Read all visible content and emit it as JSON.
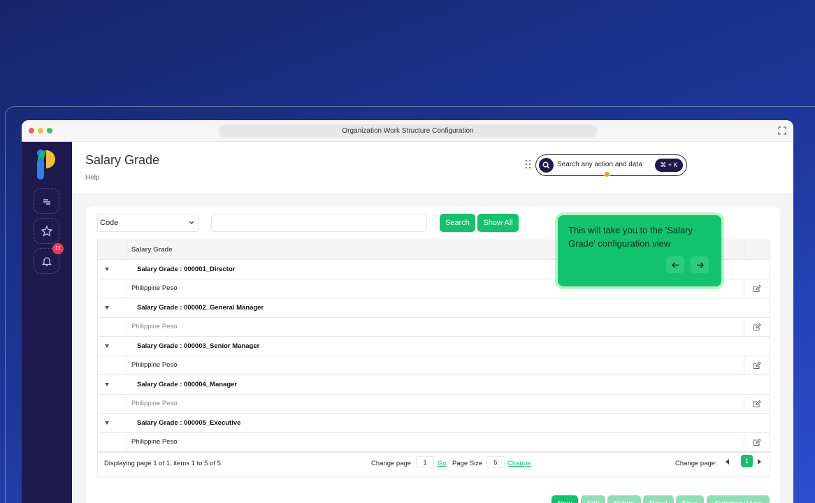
{
  "window": {
    "url_title": "Organization Work Structure Configuration"
  },
  "sidebar": {
    "notification_count": "11"
  },
  "header": {
    "title": "Salary Grade",
    "help": "Help",
    "search_placeholder": "Search any action and data",
    "shortcut": "⌘ + K"
  },
  "filters": {
    "field_select": "Code",
    "search_value": "",
    "search_label": "Search",
    "show_all_label": "Show All"
  },
  "table": {
    "column_header": "Salary Grade",
    "groups": [
      {
        "label": "Salary Grade : 000001_Director",
        "currency": "Philippine Peso"
      },
      {
        "label": "Salary Grade : 000002_General Manager",
        "currency": "Philippine Peso"
      },
      {
        "label": "Salary Grade : 000003_Senior Manager",
        "currency": "Philippine Peso"
      },
      {
        "label": "Salary Grade : 000004_Manager",
        "currency": "Philippine Peso"
      },
      {
        "label": "Salary Grade : 000005_Executive",
        "currency": "Philippine Peso"
      }
    ]
  },
  "pager": {
    "info": "Displaying page 1 of 1, items 1 to 5 of 5.",
    "change_page_label": "Change page",
    "page_value": "1",
    "go": "Go",
    "page_size_label": "Page Size",
    "page_size_value": "5",
    "change": "Change",
    "change_page_label_right": "Change page:",
    "current_page": "1"
  },
  "actions": {
    "new": "New",
    "edit": "Edit",
    "delete": "Delete",
    "reset": "Reset",
    "save": "Save",
    "summary_view": "Summary View"
  },
  "tooltip": {
    "text": "This will take you to the 'Salary Grade' configuration view"
  },
  "colors": {
    "accent": "#14c26b",
    "sidebar": "#1e1a4d",
    "badge": "#ef3a52"
  }
}
